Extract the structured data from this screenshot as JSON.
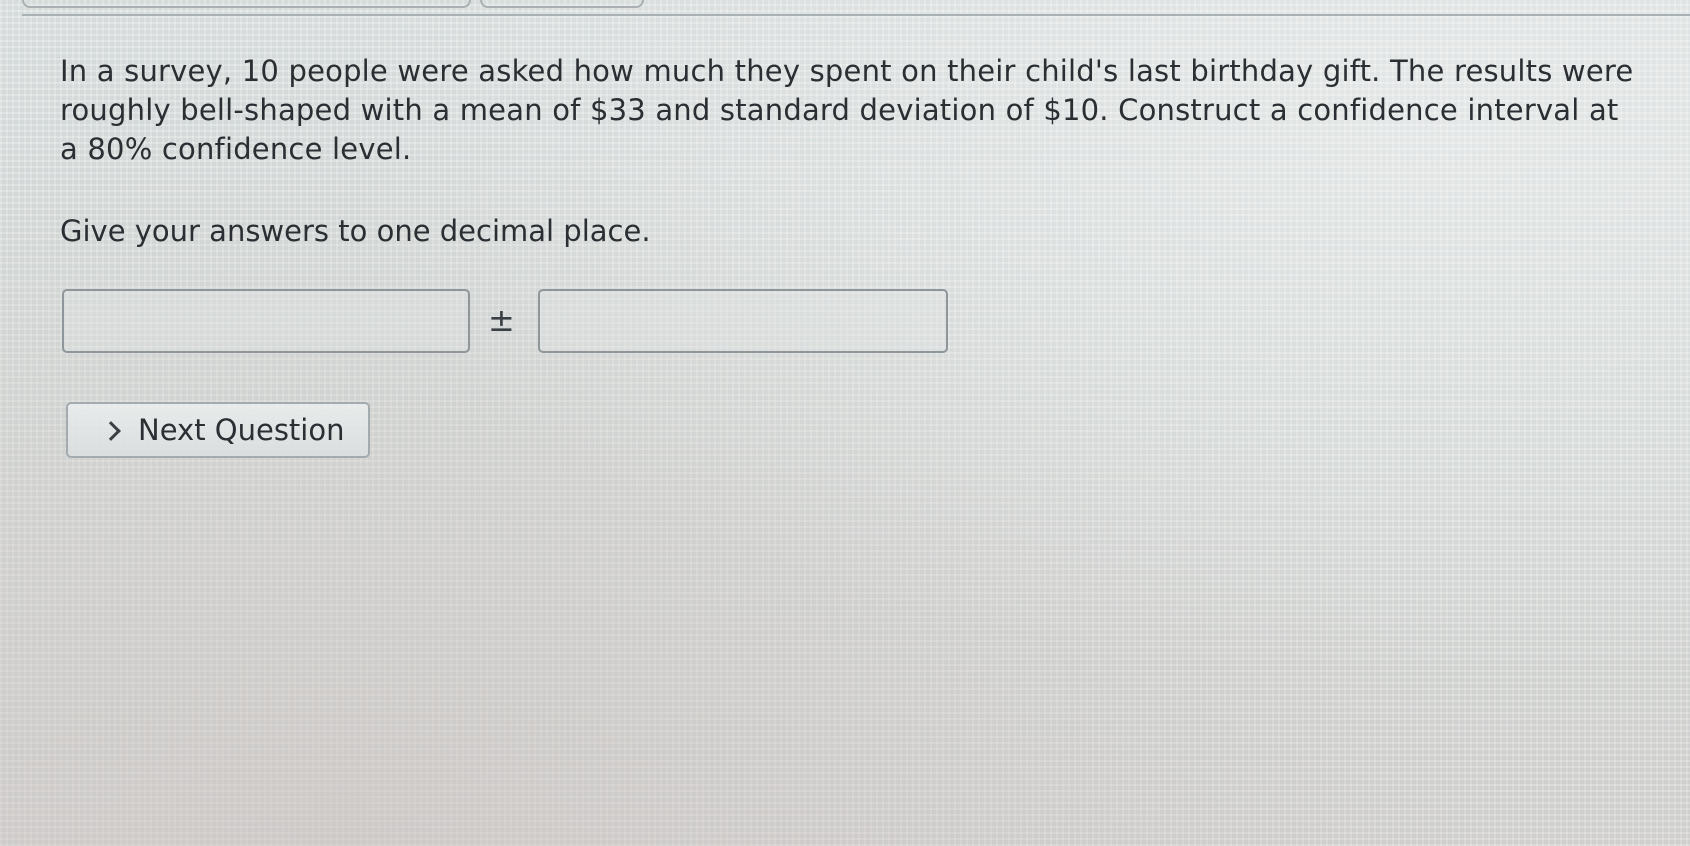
{
  "question": {
    "text": "In a survey, 10 people were asked how much they spent on their child's last birthday gift. The results were roughly bell-shaped with a mean of $33 and standard deviation of $10. Construct a confidence interval at a 80% confidence level."
  },
  "instruction": {
    "text": "Give your answers to one decimal place."
  },
  "answer": {
    "left_value": "",
    "operator": "±",
    "right_value": ""
  },
  "navigation": {
    "next_label": "Next Question",
    "next_icon": "chevron-right-icon"
  }
}
